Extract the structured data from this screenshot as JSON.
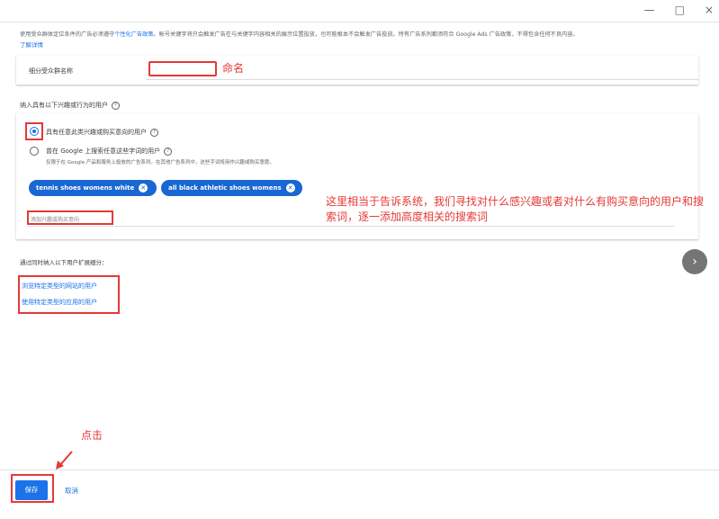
{
  "window": {
    "minimize": "—",
    "maximize": "□",
    "close": "×"
  },
  "notice": {
    "text_before": "使用受众群体定位条件的广告必须遵守",
    "policy_link": "个性化广告政策",
    "text_after": "。帐号关键字将只会触发广告在与关键字内容相关的展示位置投放，也可能根本不会触发广告投放。所有广告系列都须符合 Google Ads 广告政策，不得包含任何不良内容。",
    "learn_more": "了解详情"
  },
  "segment_name": {
    "label": "细分受众群名称",
    "value": ""
  },
  "section": {
    "title": "纳入具有以下兴趣或行为的用户"
  },
  "options": [
    {
      "label": "具有任意此类兴趣或购买意向的用户",
      "checked": true
    },
    {
      "label": "曾在 Google 上搜索任意这些字词的用户",
      "sub": "仅限于在 Google 产品和服务上投放的广告系列。在其他广告系列中，这些字词将用作兴趣或购买意愿。",
      "checked": false
    }
  ],
  "chips": [
    "tennis shoes womens white",
    "all black athletic shoes womens"
  ],
  "add_input": {
    "placeholder": "添加兴趣或购买意向"
  },
  "expand": {
    "title": "通过同时纳入以下用户扩展细分：",
    "links": [
      "浏览特定类型的网站的用户",
      "使用特定类型的应用的用户"
    ]
  },
  "annotations": {
    "name": "命名",
    "explain": "这里相当于告诉系统，我们寻找对什么感兴趣或者对什么有购买意向的用户和搜索词，逐一添加高度相关的搜索词",
    "click": "点击"
  },
  "footer": {
    "save": "保存",
    "cancel": "取消"
  },
  "colors": {
    "accent": "#1a73e8",
    "annotation": "#e53935"
  }
}
